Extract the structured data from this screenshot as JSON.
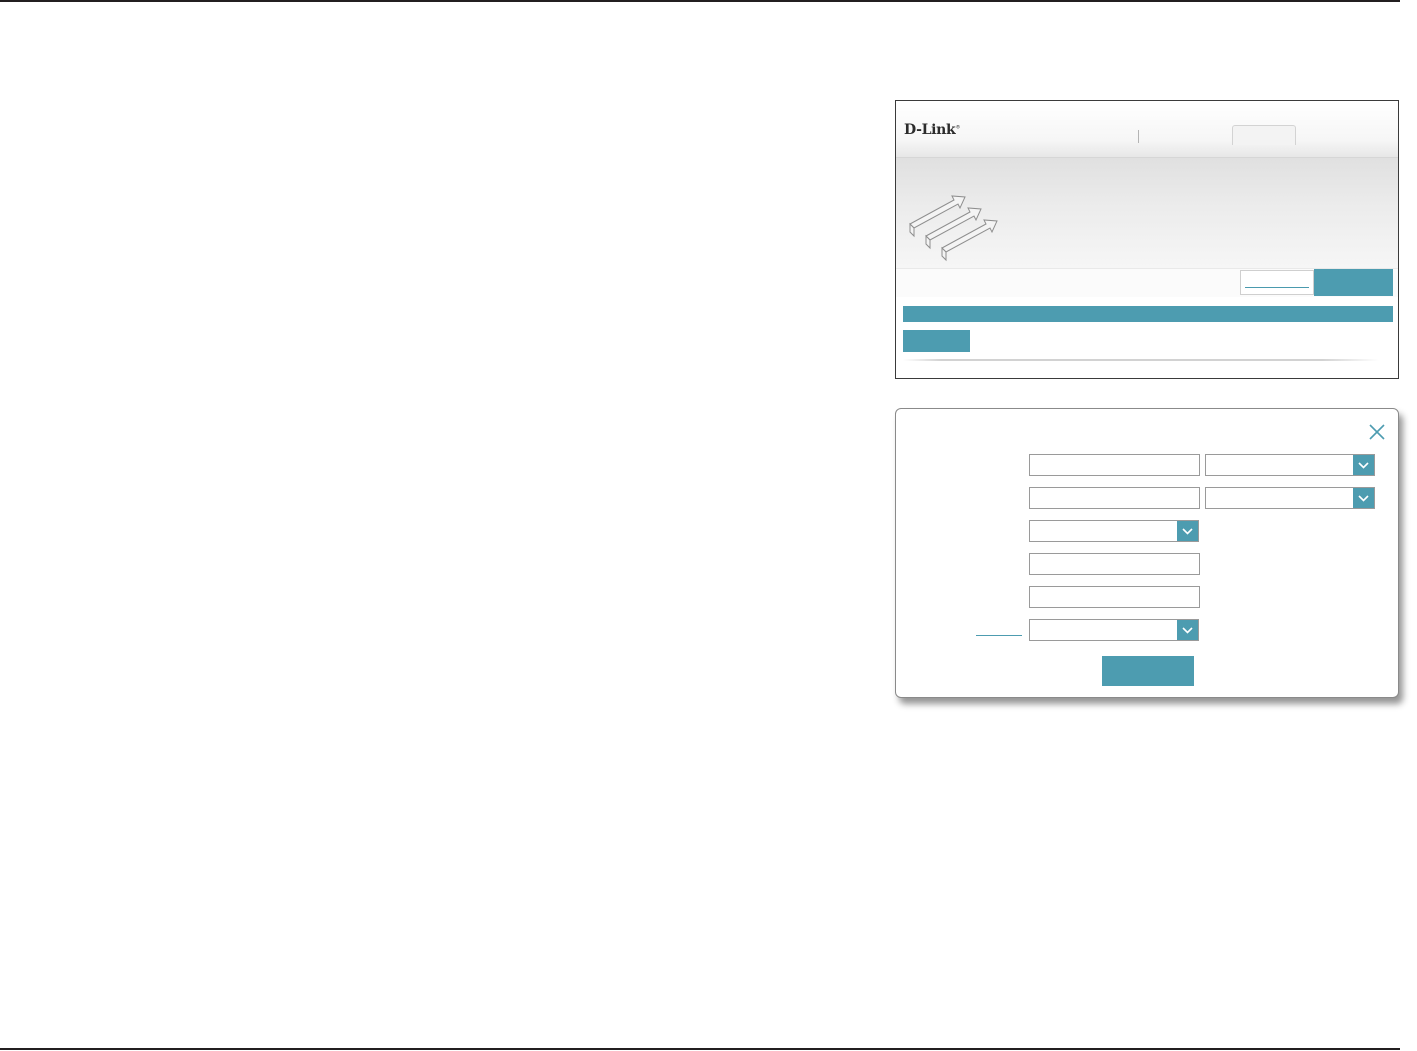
{
  "brand": {
    "logo_text": "D-Link",
    "logo_mark": "®",
    "accent_color": "#4d9cb0"
  },
  "icons": {
    "banner": "stacked-arrows-icon",
    "close": "close-icon",
    "dropdown": "chevron-down-icon"
  },
  "dialog": {
    "fields": [
      {
        "type": "text"
      },
      {
        "type": "select"
      },
      {
        "type": "text"
      },
      {
        "type": "select"
      },
      {
        "type": "select"
      },
      {
        "type": "text"
      },
      {
        "type": "text"
      },
      {
        "type": "select"
      }
    ]
  }
}
